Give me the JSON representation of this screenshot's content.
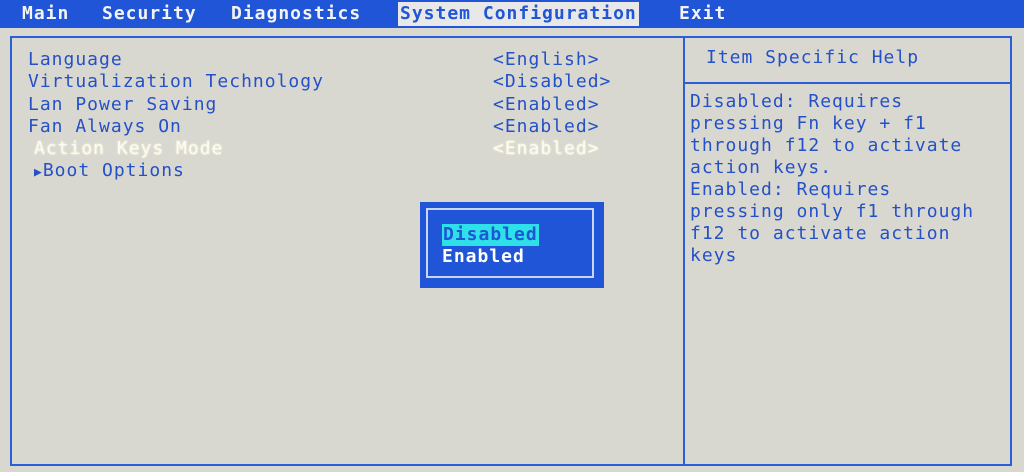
{
  "menubar": {
    "tabs": [
      {
        "label": "Main"
      },
      {
        "label": "Security"
      },
      {
        "label": "Diagnostics"
      },
      {
        "label": "System Configuration"
      },
      {
        "label": "Exit"
      }
    ],
    "active_tab": "System Configuration"
  },
  "settings": [
    {
      "label": "Language",
      "value": "<English>"
    },
    {
      "label": "Virtualization Technology",
      "value": "<Disabled>"
    },
    {
      "label": "Lan Power Saving",
      "value": "<Enabled>"
    },
    {
      "label": "Fan Always On",
      "value": "<Enabled>"
    },
    {
      "label": "Action Keys Mode",
      "value": "<Enabled>",
      "selected": true
    },
    {
      "label": "Boot Options",
      "submenu_marker": "▶"
    }
  ],
  "help": {
    "title": "Item Specific Help",
    "lines": [
      "Disabled: Requires",
      "pressing Fn key + f1",
      "through f12 to activate",
      "action keys.",
      "Enabled: Requires",
      "pressing only f1 through",
      "f12 to activate action",
      "keys"
    ]
  },
  "popup": {
    "options": [
      "Disabled",
      "Enabled"
    ],
    "highlighted": "Disabled"
  },
  "colors": {
    "bar_blue": "#1f55d6",
    "text_blue": "#2450c8",
    "background": "#d9d8d0",
    "highlight_cyan": "#2ee0e8",
    "selected_text": "#fbfbf4"
  }
}
